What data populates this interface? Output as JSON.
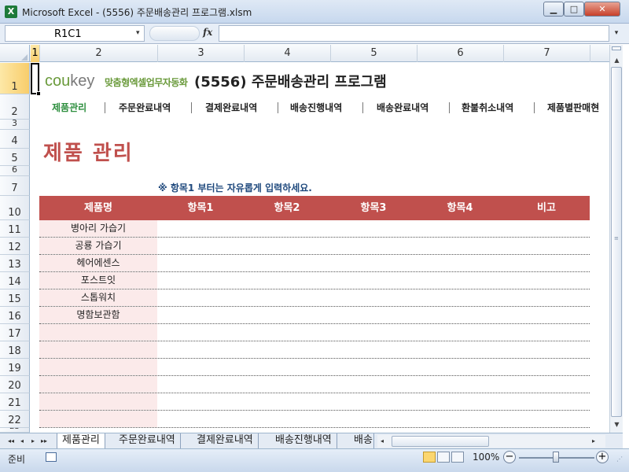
{
  "window": {
    "title": "Microsoft Excel - (5556) 주문배송관리 프로그램.xlsm",
    "app_icon": "X",
    "min": "▁",
    "max": "□",
    "close": "✕"
  },
  "formula_bar": {
    "name_box": "R1C1",
    "name_arrow": "▾",
    "fx": "fx",
    "formula": "",
    "expand": "▾"
  },
  "columns": [
    "1",
    "2",
    "3",
    "4",
    "5",
    "6",
    "7"
  ],
  "rows": [
    "1",
    "2",
    "3",
    "4",
    "5",
    "6",
    "7",
    "10",
    "11",
    "12",
    "13",
    "14",
    "15",
    "16",
    "17",
    "18",
    "19",
    "20",
    "21",
    "22",
    "23"
  ],
  "sheet": {
    "logo_brand_a": "cou",
    "logo_brand_b": "key",
    "logo_tagline": "맞춤형엑셀업무자동화",
    "program_title": "(5556) 주문배송관리 프로그램",
    "menu": [
      "제품관리",
      "주문완료내역",
      "결제완료내역",
      "배송진행내역",
      "배송완료내역",
      "환불취소내역",
      "제품별판매현"
    ],
    "page_heading": "제품 관리",
    "hint": "※ 항목1 부터는 자유롭게 입력하세요.",
    "table_headers": [
      "제품명",
      "항목1",
      "항목2",
      "항목3",
      "항목4",
      "비고"
    ],
    "products": [
      "병아리 가습기",
      "공룡 가습기",
      "헤어에센스",
      "포스트잇",
      "스톱워치",
      "명함보관함",
      "",
      "",
      "",
      "",
      "",
      ""
    ],
    "header_color": "#c0504d",
    "accent_green": "#2e8f3f"
  },
  "tabs": {
    "nav": [
      "◂◂",
      "◂",
      "▸",
      "▸▸"
    ],
    "sheets": [
      "제품관리",
      "주문완료내역",
      "결제완료내역",
      "배송진행내역",
      "배송"
    ]
  },
  "scroll": {
    "up": "▲",
    "down": "▼",
    "left": "◂",
    "right": "▸"
  },
  "status": {
    "ready": "준비",
    "zoom": "100%",
    "zoom_out": "−",
    "zoom_in": "+"
  }
}
